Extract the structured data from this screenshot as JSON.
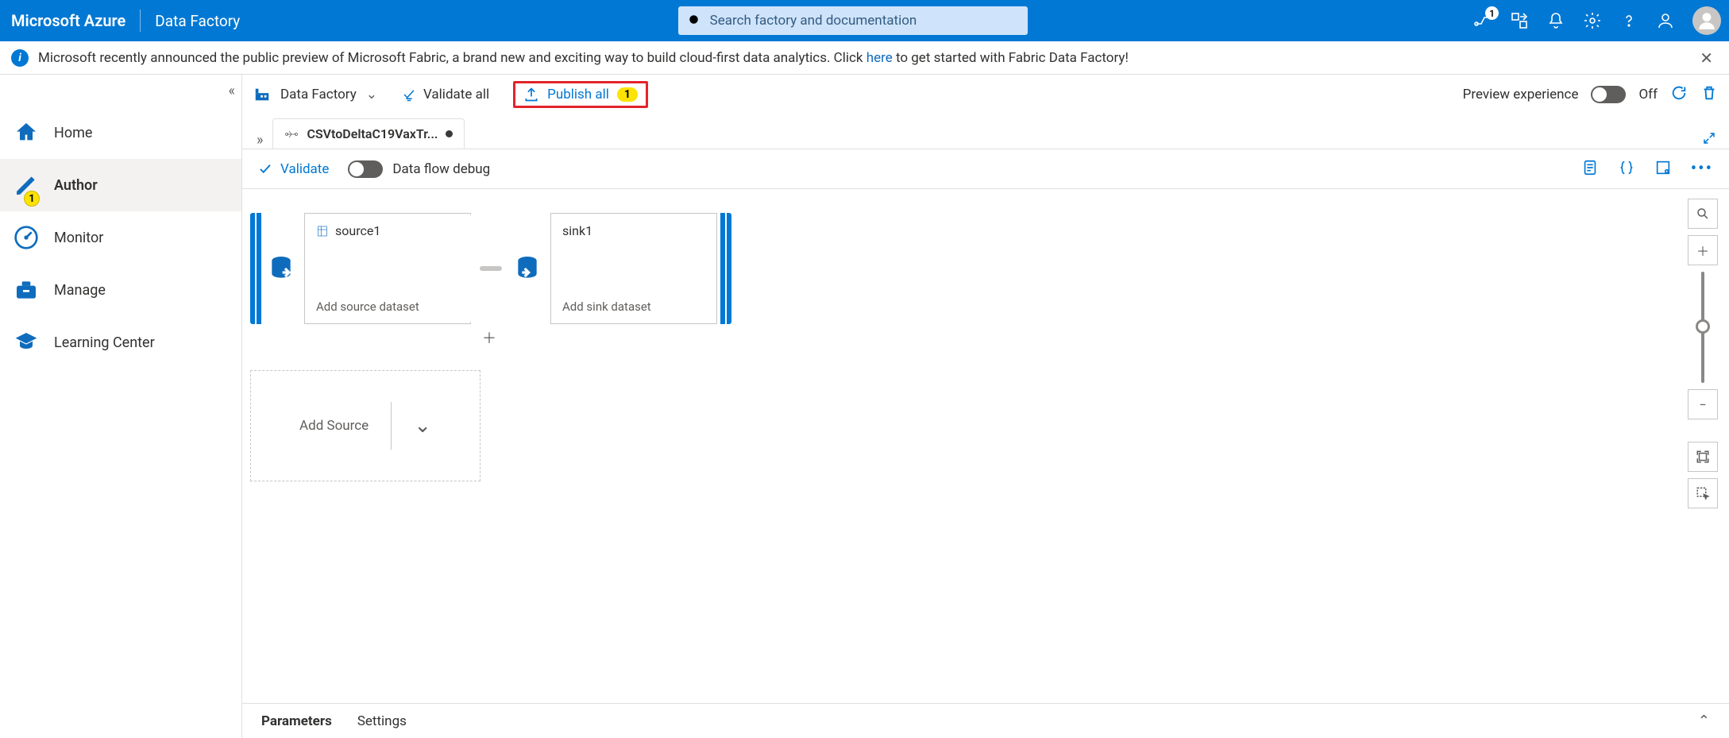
{
  "topbar": {
    "brand": "Microsoft Azure",
    "service": "Data Factory",
    "search_placeholder": "Search factory and documentation",
    "diag_badge": "1"
  },
  "notice": {
    "text_before": "Microsoft recently announced the public preview of Microsoft Fabric, a brand new and exciting way to build cloud-first data analytics. Click ",
    "link_text": "here",
    "text_after": " to get started with Fabric Data Factory!"
  },
  "leftnav": {
    "items": [
      {
        "label": "Home"
      },
      {
        "label": "Author",
        "badge": "1",
        "active": true
      },
      {
        "label": "Monitor"
      },
      {
        "label": "Manage"
      },
      {
        "label": "Learning Center"
      }
    ]
  },
  "toolbar": {
    "factory_label": "Data Factory",
    "validate_all": "Validate all",
    "publish_all": "Publish all",
    "publish_badge": "1",
    "preview": "Preview experience",
    "off": "Off"
  },
  "tab": {
    "title": "CSVtoDeltaC19VaxTr..."
  },
  "actionrow": {
    "validate": "Validate",
    "debug": "Data flow debug"
  },
  "canvas": {
    "source": {
      "name": "source1",
      "hint": "Add source dataset"
    },
    "sink": {
      "name": "sink1",
      "hint": "Add sink dataset"
    },
    "add_source": "Add Source"
  },
  "bottombar": {
    "tabs": [
      {
        "label": "Parameters",
        "active": true
      },
      {
        "label": "Settings"
      }
    ]
  }
}
